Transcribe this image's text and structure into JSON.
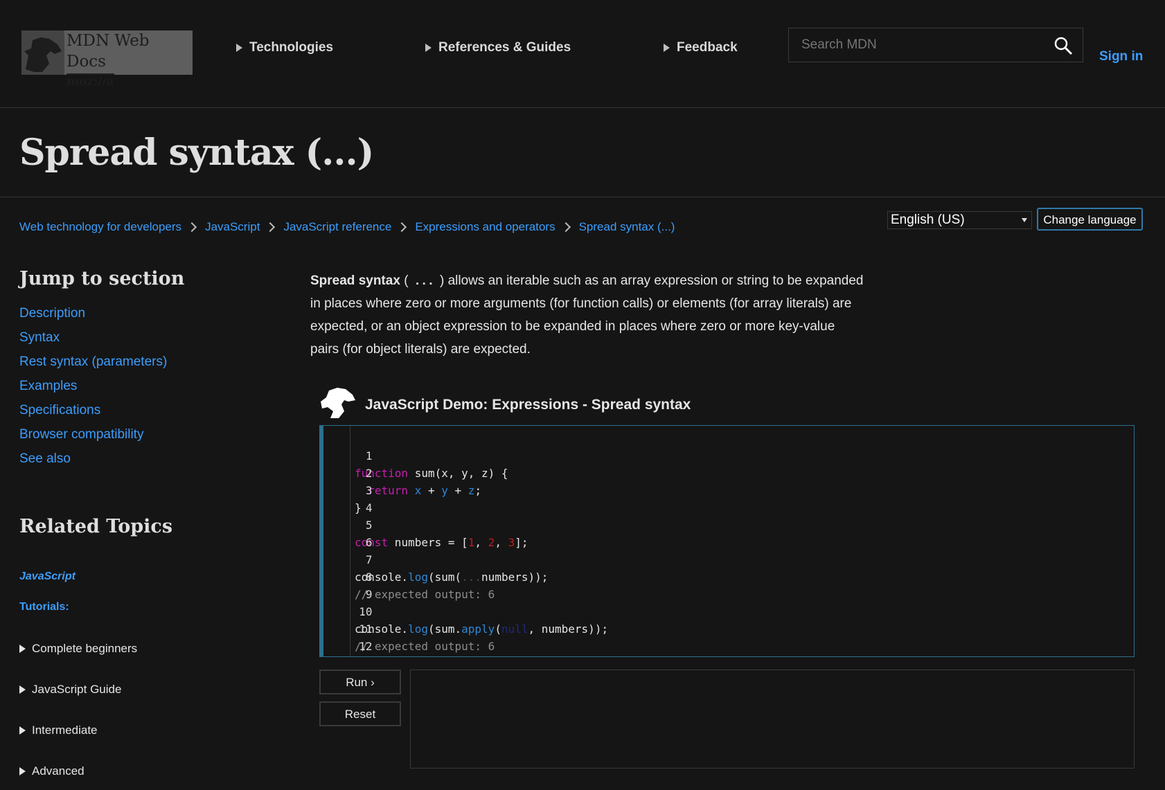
{
  "header": {
    "logo_main": "MDN Web Docs",
    "logo_sub": "moz://a",
    "nav": [
      "Technologies",
      "References & Guides",
      "Feedback"
    ],
    "search_placeholder": "Search MDN",
    "signin": "Sign in"
  },
  "page_title": "Spread syntax (...)",
  "breadcrumbs": [
    "Web technology for developers",
    "JavaScript",
    "JavaScript reference",
    "Expressions and operators",
    "Spread syntax (...)"
  ],
  "language": {
    "selected": "English (US)",
    "button": "Change language"
  },
  "sidebar": {
    "jump_heading": "Jump to section",
    "sections": [
      "Description",
      "Syntax",
      "Rest syntax (parameters)",
      "Examples",
      "Specifications",
      "Browser compatibility",
      "See also"
    ],
    "related_heading": "Related Topics",
    "related_link": "JavaScript",
    "tutorials_label": "Tutorials:",
    "tutorials": [
      "Complete beginners",
      "JavaScript Guide",
      "Intermediate",
      "Advanced"
    ]
  },
  "intro": {
    "term": "Spread syntax",
    "code": "...",
    "text": ") allows an iterable such as an array expression or string to be expanded in places where zero or more arguments (for function calls) or elements (for array literals) are expected, or an object expression to be expanded in places where zero or more key-value pairs (for object literals) are expected.",
    "open_paren": "("
  },
  "demo": {
    "title": "JavaScript Demo: Expressions - Spread syntax",
    "line_numbers": [
      "1",
      "2",
      "3",
      "4",
      "5",
      "6",
      "7",
      "8",
      "9",
      "10",
      "11",
      "12"
    ],
    "code": [
      "function sum(x, y, z) {",
      "  return x + y + z;",
      "}",
      "",
      "const numbers = [1, 2, 3];",
      "",
      "console.log(sum(...numbers));",
      "// expected output: 6",
      "",
      "console.log(sum.apply(null, numbers));",
      "// expected output: 6",
      ""
    ],
    "run": "Run ›",
    "reset": "Reset"
  }
}
